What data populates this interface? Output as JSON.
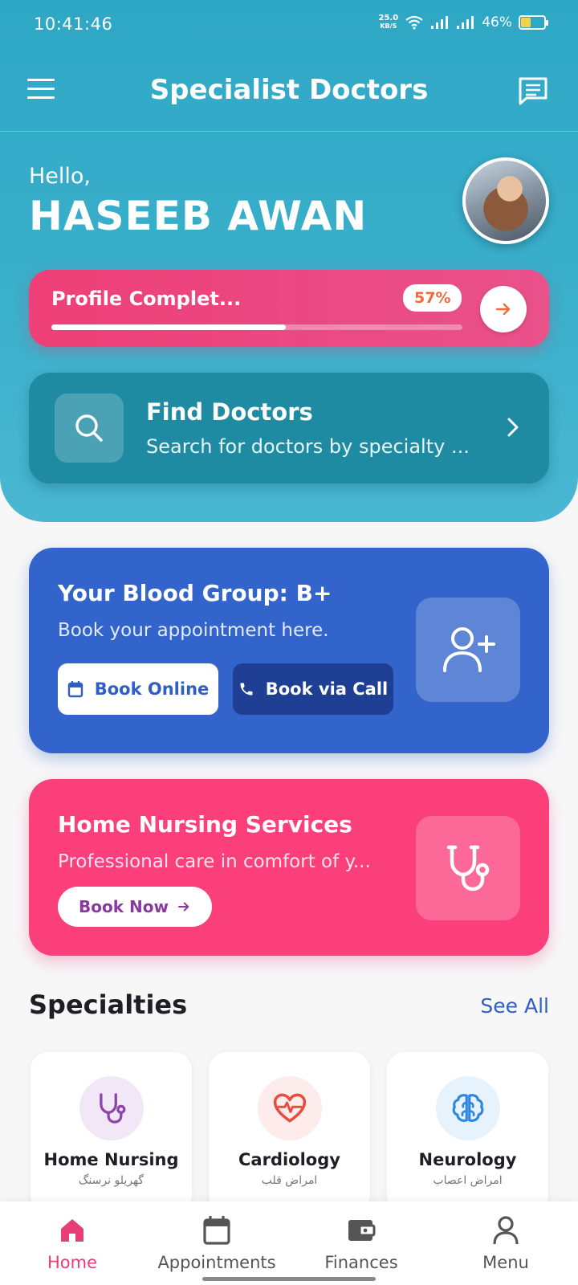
{
  "status_bar": {
    "time": "10:41:46",
    "net_speed_value": "25.0",
    "net_speed_unit": "KB/S",
    "battery": "46%",
    "battery_level": 0.46
  },
  "app_bar": {
    "title": "Specialist Doctors",
    "menu_icon": "hamburger-menu-icon",
    "chat_icon": "chat-message-icon"
  },
  "greeting": {
    "hello": "Hello,",
    "name": "HASEEB AWAN"
  },
  "profile": {
    "label": "Profile Complet...",
    "percent_text": "57%",
    "progress": 0.57
  },
  "find_doctors": {
    "title": "Find Doctors",
    "subtitle": "Search for doctors by specialty ..."
  },
  "blood": {
    "title": "Your Blood Group: B+",
    "subtitle": "Book your appointment here.",
    "book_online": "Book Online",
    "book_call": "Book via Call"
  },
  "nursing": {
    "title": "Home Nursing Services",
    "subtitle": "Professional care in comfort of y...",
    "book_now": "Book Now"
  },
  "specialties": {
    "title": "Specialties",
    "see_all": "See All",
    "items": [
      {
        "name": "Home Nursing",
        "urdu": "گھریلو نرسنگ",
        "icon": "stethoscope-icon",
        "color": "#8e44ad"
      },
      {
        "name": "Cardiology",
        "urdu": "امراض قلب",
        "icon": "heart-pulse-icon",
        "color": "#e74c3c"
      },
      {
        "name": "Neurology",
        "urdu": "امراض اعصاب",
        "icon": "brain-icon",
        "color": "#2e86de"
      }
    ]
  },
  "bottom_nav": [
    {
      "label": "Home",
      "icon": "home-icon",
      "active": true
    },
    {
      "label": "Appointments",
      "icon": "calendar-icon",
      "active": false
    },
    {
      "label": "Finances",
      "icon": "wallet-icon",
      "active": false
    },
    {
      "label": "Menu",
      "icon": "person-icon",
      "active": false
    }
  ],
  "colors": {
    "header": "#2ea7c6",
    "profile_card": "#ee3f78",
    "find_card": "#1f8ba2",
    "blood_card": "#3264cb",
    "nursing_card": "#fb3f7b",
    "accent_pink": "#e83e78",
    "link_blue": "#2f5fc4"
  }
}
